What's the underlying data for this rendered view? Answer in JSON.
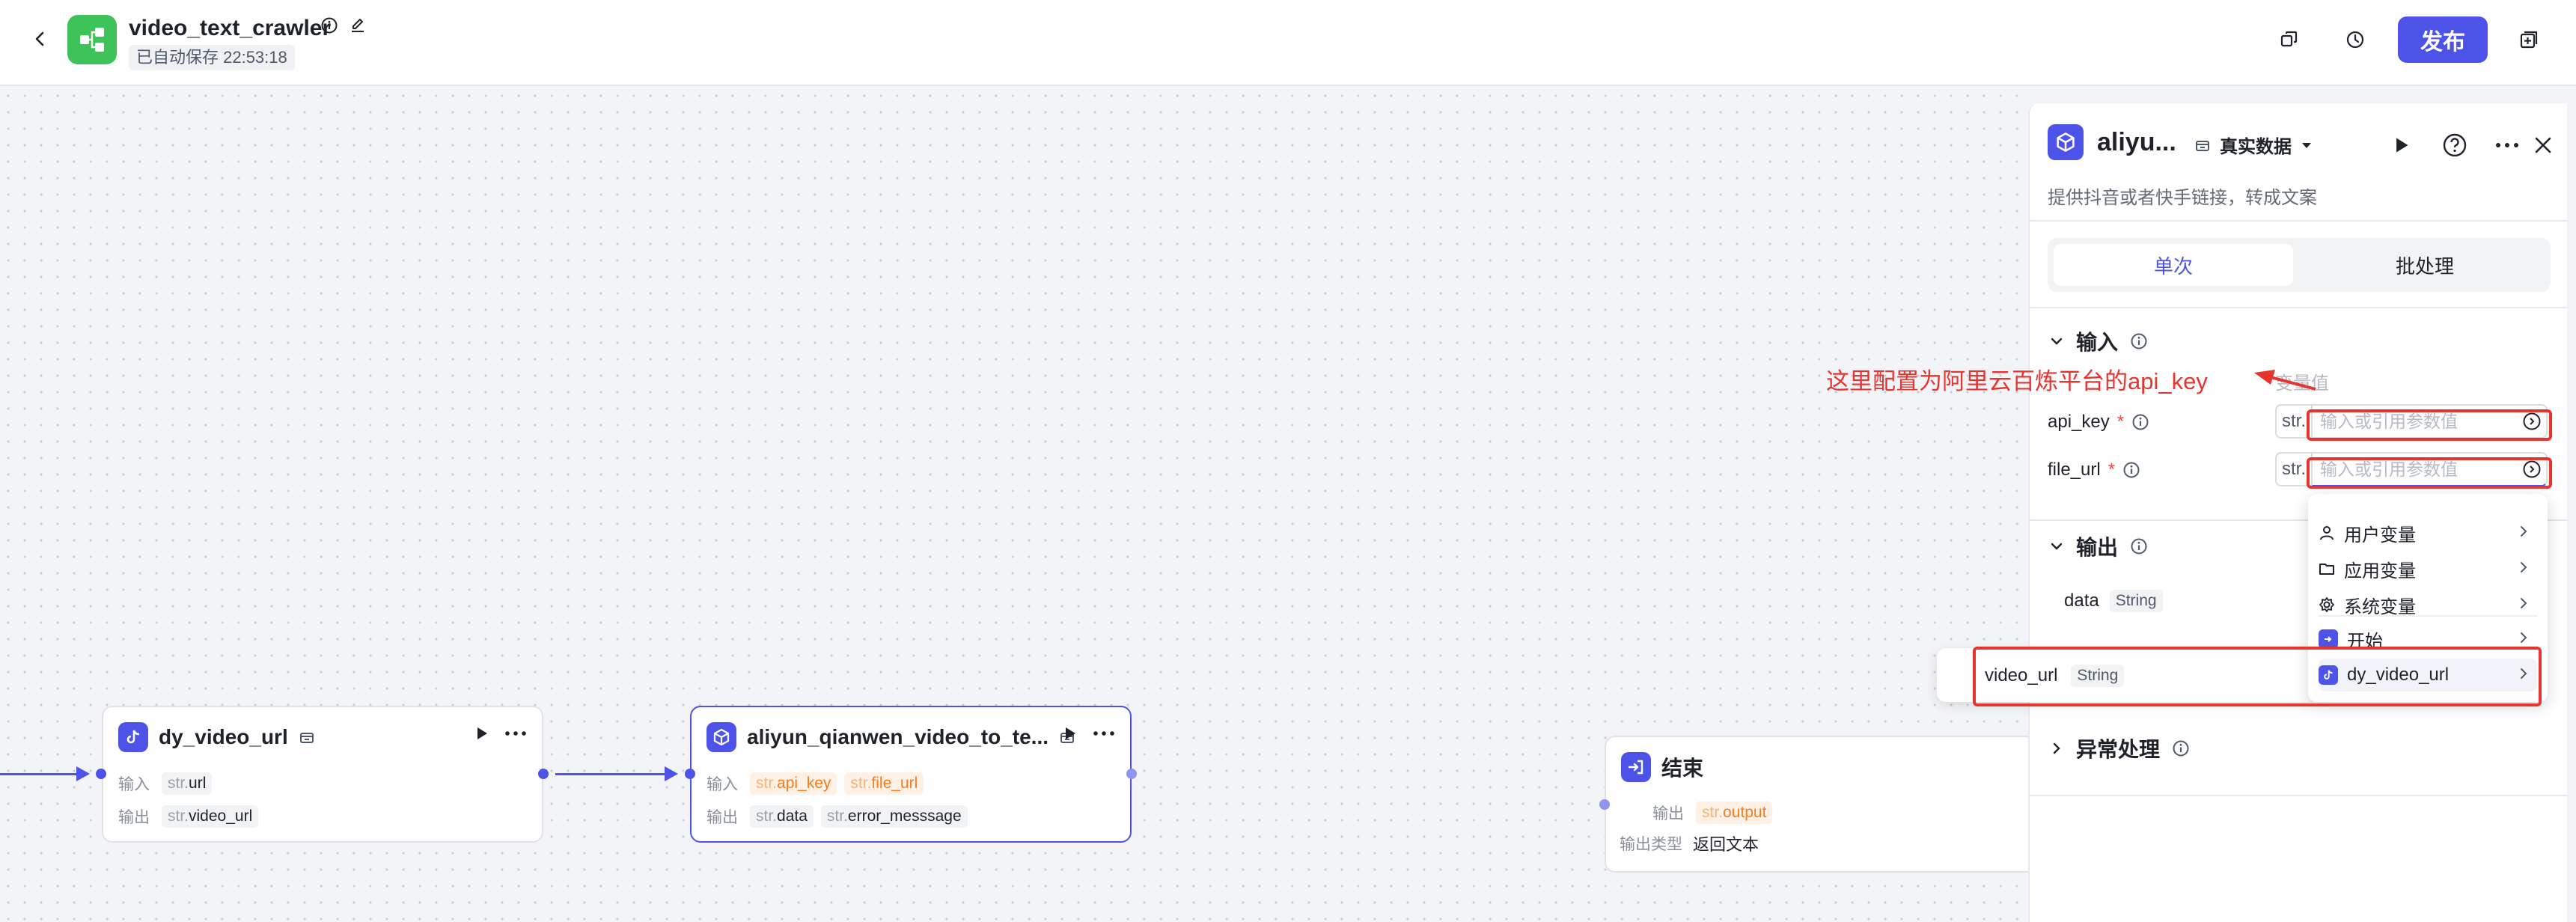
{
  "header": {
    "title": "video_text_crawler",
    "autosave": "已自动保存 22:53:18",
    "publish_label": "发布"
  },
  "nodes": {
    "dy": {
      "title": "dy_video_url",
      "input_label": "输入",
      "input_param": "url",
      "output_label": "输出",
      "output_param": "video_url",
      "type_prefix": "str."
    },
    "aliyun": {
      "title": "aliyun_qianwen_video_to_te...",
      "input_label": "输入",
      "inputs": [
        "api_key",
        "file_url"
      ],
      "output_label": "输出",
      "outputs": [
        "data",
        "error_messsage"
      ],
      "type_prefix": "str."
    },
    "end": {
      "title": "结束",
      "output_label": "输出",
      "output_param": "output",
      "output_type_label": "输出类型",
      "output_type_value": "返回文本",
      "type_prefix": "str."
    }
  },
  "panel": {
    "name": "aliyu...",
    "mode": "真实数据",
    "description": "提供抖音或者快手链接，转成文案",
    "tabs": [
      "单次",
      "批处理"
    ],
    "input_section": "输入",
    "hint_obscured": "变量值",
    "params": [
      {
        "name": "api_key",
        "type": "str.",
        "placeholder": "输入或引用参数值"
      },
      {
        "name": "file_url",
        "type": "str.",
        "placeholder": "输入或引用参数值"
      }
    ],
    "output_section": "输出",
    "output_field": {
      "name": "data",
      "type": "String"
    },
    "exception_section": "异常处理"
  },
  "dropdown": {
    "items": [
      "用户变量",
      "应用变量",
      "系统变量",
      "开始",
      "dy_video_url"
    ]
  },
  "float_item": {
    "name": "video_url",
    "type": "String"
  },
  "annotation": {
    "text": "这里配置为阿里云百炼平台的api_key",
    "color": "#e8342f"
  },
  "colors": {
    "accent": "#4d53e8",
    "logo_green": "#3ec35a",
    "orange": "#f57c1f"
  }
}
